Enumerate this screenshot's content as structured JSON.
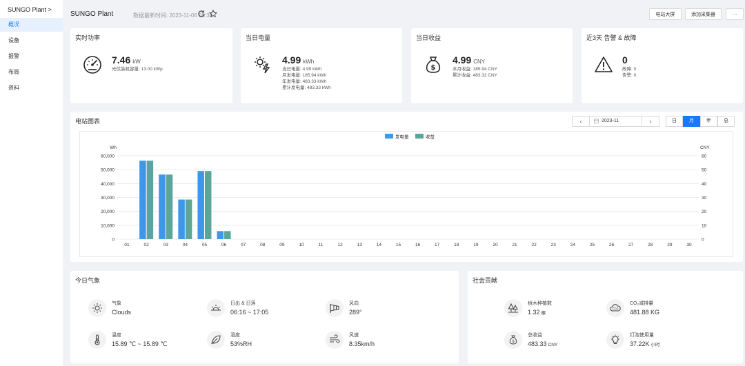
{
  "sidebar": {
    "brand": "SUNGO Plant >",
    "items": [
      {
        "label": "概况",
        "active": true
      },
      {
        "label": "设备"
      },
      {
        "label": "报警"
      },
      {
        "label": "布局"
      },
      {
        "label": "资料"
      }
    ]
  },
  "header": {
    "title": "SUNGO Plant",
    "updated": "数据最新时间: 2023-11-06 09:34",
    "btn_bigscreen": "电站大屏",
    "btn_add_collector": "添加采集器",
    "btn_more": "···"
  },
  "kpis": {
    "power": {
      "title": "实时功率",
      "value": "7.46",
      "unit": "kW",
      "sub": [
        "光伏装机容量: 13.00 kWp"
      ]
    },
    "energy": {
      "title": "当日电量",
      "value": "4.99",
      "unit": "kWh",
      "sub": [
        "当日电量: 4.99 kWh",
        "月发电量: 185.94 kWh",
        "年发电量: 483.33 kWh",
        "累计发电量: 483.33 kWh"
      ]
    },
    "income": {
      "title": "当日收益",
      "value": "4.99",
      "unit": "CNY",
      "sub": [
        "本月收益: 185.94 CNY",
        "累计收益: 483.32 CNY"
      ]
    },
    "alarms": {
      "title": "近3天 告警 & 故障",
      "value": "0",
      "unit": "",
      "sub": [
        "故障: 0",
        "告警: 0"
      ]
    }
  },
  "chart_panel": {
    "title": "电站图表",
    "date": "2023-11",
    "prev": "‹",
    "next": "›",
    "tabs": [
      "日",
      "月",
      "年",
      "总"
    ],
    "active_tab": "月"
  },
  "chart_data": {
    "type": "bar",
    "categories": [
      "01",
      "02",
      "03",
      "04",
      "05",
      "06",
      "07",
      "08",
      "09",
      "10",
      "11",
      "12",
      "13",
      "14",
      "15",
      "16",
      "17",
      "18",
      "19",
      "20",
      "21",
      "22",
      "23",
      "24",
      "25",
      "26",
      "27",
      "28",
      "29",
      "30"
    ],
    "series": [
      {
        "name": "发电量",
        "color": "#3d97ea",
        "axis": "left",
        "values": [
          0,
          56500,
          46500,
          28500,
          49000,
          5800,
          0,
          0,
          0,
          0,
          0,
          0,
          0,
          0,
          0,
          0,
          0,
          0,
          0,
          0,
          0,
          0,
          0,
          0,
          0,
          0,
          0,
          0,
          0,
          0
        ]
      },
      {
        "name": "收益",
        "color": "#5ba69b",
        "axis": "right",
        "values": [
          0,
          56.5,
          46.5,
          28.5,
          49,
          5.8,
          0,
          0,
          0,
          0,
          0,
          0,
          0,
          0,
          0,
          0,
          0,
          0,
          0,
          0,
          0,
          0,
          0,
          0,
          0,
          0,
          0,
          0,
          0,
          0
        ]
      }
    ],
    "ylabel_left": "Wh",
    "ylabel_right": "CNY",
    "ylim_left": [
      0,
      60000
    ],
    "ylim_right": [
      0,
      60
    ],
    "yticks_left": [
      "0",
      "10,000",
      "20,000",
      "30,000",
      "40,000",
      "50,000",
      "60,000"
    ],
    "yticks_right": [
      "0",
      "10",
      "20",
      "30",
      "40",
      "50",
      "60"
    ],
    "legend": "top-center",
    "grid": true
  },
  "weather": {
    "title": "今日气象",
    "items": [
      {
        "icon": "sun-icon",
        "label": "气象",
        "value": "Clouds"
      },
      {
        "icon": "sunrise-icon",
        "label": "日出 & 日落",
        "value": "06:16 ~ 17:05"
      },
      {
        "icon": "windsock-icon",
        "label": "风向",
        "value": "289°"
      },
      {
        "icon": "thermometer-icon",
        "label": "温度",
        "value": "15.89 ℃ ~ 15.89 ℃"
      },
      {
        "icon": "leaf-icon",
        "label": "湿度",
        "value": "53%RH"
      },
      {
        "icon": "wind-icon",
        "label": "风速",
        "value": "8.35km/h"
      }
    ]
  },
  "social": {
    "title": "社会贡献",
    "items": [
      {
        "icon": "trees-icon",
        "label": "树木种植数",
        "value": "1.32",
        "unit": "棵"
      },
      {
        "icon": "co2-cloud-icon",
        "label": "CO₂减排量",
        "value": "481.88 KG",
        "unit": ""
      },
      {
        "icon": "money-bag-icon",
        "label": "总收益",
        "value": "483.33",
        "unit": "CNY"
      },
      {
        "icon": "bulb-icon",
        "label": "灯泡使用量",
        "value": "37.22K",
        "unit": "小时"
      }
    ]
  }
}
